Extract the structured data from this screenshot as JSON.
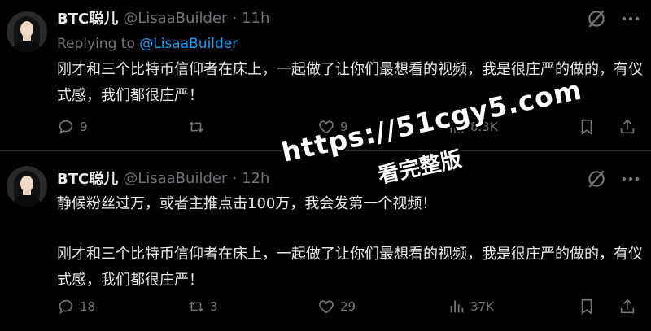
{
  "tweets": [
    {
      "name": "BTC聪儿",
      "handle": "@LisaaBuilder",
      "dot": "·",
      "time": "11h",
      "reply_prefix": "Replying to",
      "reply_mention": "@LisaaBuilder",
      "paragraphs": [
        "刚才和三个比特币信仰者在床上，一起做了让你们最想看的视频，我是很庄严的做的，有仪式感，我们都很庄严！"
      ],
      "replies": "9",
      "retweets": "",
      "likes": "9",
      "views": "8.3K"
    },
    {
      "name": "BTC聪儿",
      "handle": "@LisaaBuilder",
      "dot": "·",
      "time": "12h",
      "paragraphs": [
        "静候粉丝过万，或者主推点击100万，我会发第一个视频！",
        "刚才和三个比特币信仰者在床上，一起做了让你们最想看的视频，我是很庄严的做的，有仪式感，我们都很庄严！"
      ],
      "replies": "18",
      "retweets": "3",
      "likes": "29",
      "views": "37K"
    }
  ],
  "watermark": {
    "url": "https://51cgy5.com",
    "sub": "看完整版"
  },
  "colors": {
    "background": "#000000",
    "text": "#e7e9ea",
    "muted": "#71767b",
    "link": "#1d9bf0",
    "divider": "#2f3336"
  },
  "icons": [
    "grok-icon",
    "more-icon",
    "reply-icon",
    "retweet-icon",
    "like-icon",
    "views-icon",
    "bookmark-icon",
    "share-icon"
  ]
}
